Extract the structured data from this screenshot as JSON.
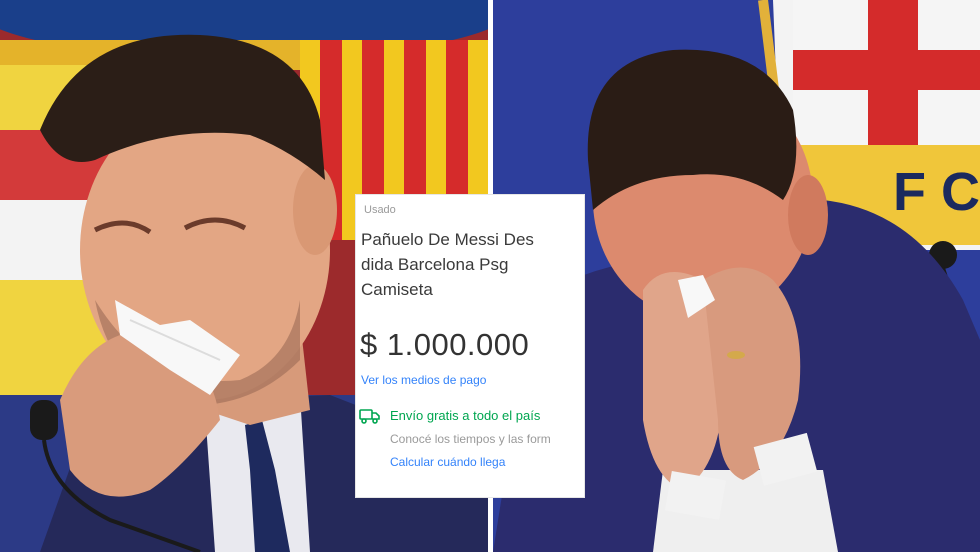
{
  "listing": {
    "condition": "Usado",
    "title_lines": [
      "Pañuelo De Messi Des",
      "dida Barcelona Psg",
      "Camiseta"
    ],
    "price": "$ 1.000.000",
    "payment_link": "Ver los medios de pago",
    "shipping": {
      "free_label": "Envío gratis a todo el país",
      "subtext": "Conocé los tiempos y las form",
      "calculate_link": "Calcular cuándo llega",
      "icon": "truck-icon"
    },
    "colors": {
      "link": "#3483fa",
      "shipping_green": "#00a650",
      "price_text": "#333333"
    }
  },
  "photos": [
    {
      "name": "left-photo",
      "scene": "crying-with-tissue"
    },
    {
      "name": "right-photo",
      "scene": "hands-over-face"
    }
  ]
}
